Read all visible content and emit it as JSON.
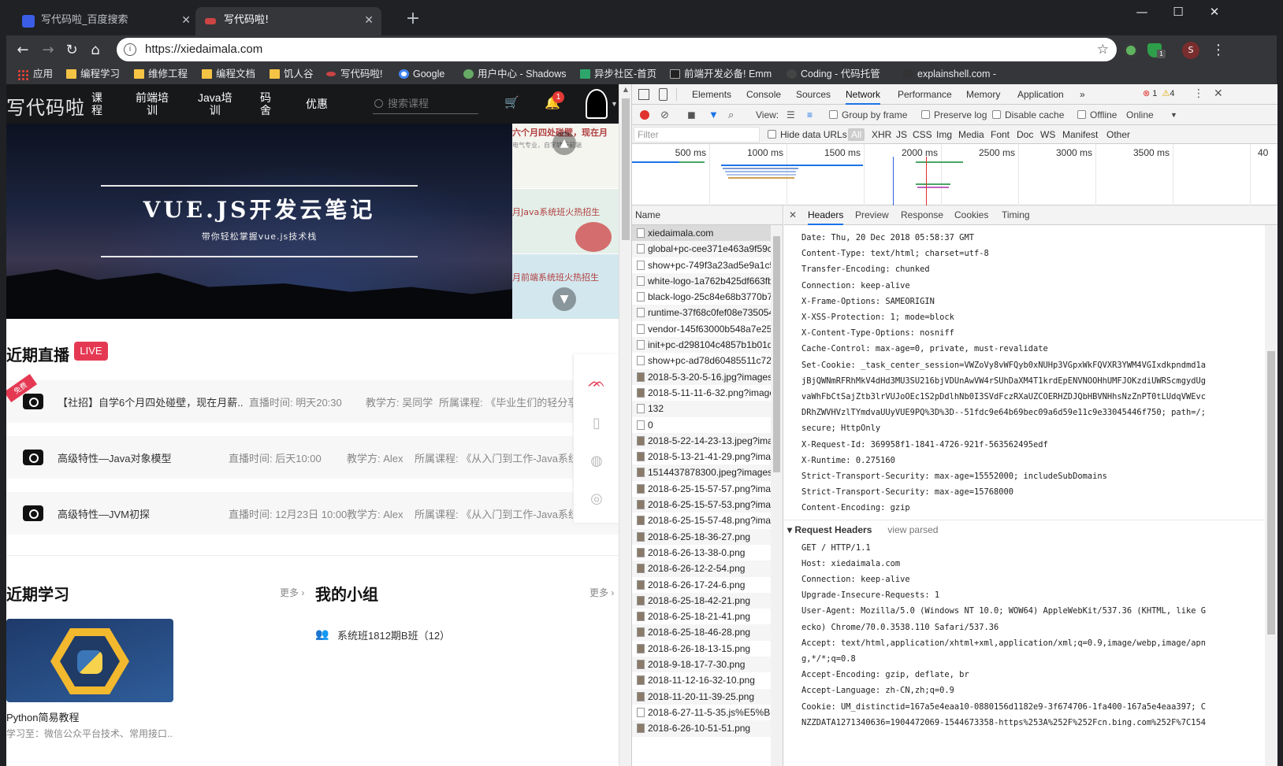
{
  "browser": {
    "tabs": [
      {
        "title": "写代码啦_百度搜索"
      },
      {
        "title": "写代码啦!"
      }
    ],
    "url": "https://xiedaimala.com",
    "bookmarks": [
      "应用",
      "编程学习",
      "维修工程",
      "编程文档",
      "饥人谷",
      "写代码啦!",
      "Google",
      "用户中心 - Shadows",
      "异步社区-首页",
      "前端开发必备! Emm",
      "Coding - 代码托管",
      "explainshell.com - r"
    ],
    "profile_letter": "S",
    "ext_badge": "1"
  },
  "site": {
    "logo": "写代码啦",
    "nav": [
      "课\n程",
      "前端培\n训",
      "Java培\n训",
      "码\n舍",
      "优惠"
    ],
    "search_placeholder": "搜索课程",
    "notif_count": "1",
    "banner_title": "VUE.JS开发云笔记",
    "banner_sub": "带你轻松掌握vue.js技术栈",
    "side_banners": [
      "六个月四处碰壁，现在月",
      "月Java系统班火热招生",
      "月前端系统班火热招生"
    ],
    "side_sub": "电气专业，自学转行前端",
    "live_title": "近期直播",
    "live_badge": "LIVE",
    "free_tag": "免费",
    "lives": [
      {
        "title": "【社招】自学6个月四处碰壁，现在月薪...",
        "time": "直播时间: 明天20:30",
        "teacher": "教学方: 吴同学",
        "course": "所属课程: 《毕业生们的轻分享合集》"
      },
      {
        "title": "高级特性—Java对象模型",
        "time": "直播时间: 后天10:00",
        "teacher": "教学方: Alex",
        "course": "所属课程: 《从入门到工作-Java系统班"
      },
      {
        "title": "高级特性—JVM初探",
        "time": "直播时间: 12月23日 10:00",
        "teacher": "教学方: Alex",
        "course": "所属课程: 《从入门到工作-Java系统班 ..."
      }
    ],
    "recent_title": "近期学习",
    "group_title": "我的小组",
    "more": "更多 ›",
    "course_title": "Python简易教程",
    "course_desc": "学习至：微信公众平台技术、常用接口...",
    "group_item": "系统班1812期B班（12）"
  },
  "devtools": {
    "tabs": [
      "Elements",
      "Console",
      "Sources",
      "Network",
      "Performance",
      "Memory",
      "Application",
      "»"
    ],
    "errors": "1",
    "warnings": "4",
    "toolbar": {
      "view": "View:",
      "group_by_frame": "Group by frame",
      "preserve_log": "Preserve log",
      "disable_cache": "Disable cache",
      "offline": "Offline",
      "online": "Online"
    },
    "filter": {
      "placeholder": "Filter",
      "hide_data_urls": "Hide data URLs",
      "all": "All",
      "types": [
        "XHR",
        "JS",
        "CSS",
        "Img",
        "Media",
        "Font",
        "Doc",
        "WS",
        "Manifest",
        "Other"
      ]
    },
    "timeline_labels": [
      "500 ms",
      "1000 ms",
      "1500 ms",
      "2000 ms",
      "2500 ms",
      "3000 ms",
      "3500 ms",
      "40"
    ],
    "name_header": "Name",
    "requests": [
      "xiedaimala.com",
      "global+pc-cee371e463a9f59cd",
      "show+pc-749f3a23ad5e9a1c5",
      "white-logo-1a762b425df663fb",
      "black-logo-25c84e68b3770b7",
      "runtime-37f68c0fef08e735054",
      "vendor-145f63000b548a7e25b",
      "init+pc-d298104c4857b1b01d",
      "show+pc-ad78d60485511c728",
      "2018-5-3-20-5-16.jpg?images",
      "2018-5-11-11-6-32.png?image",
      "132",
      "0",
      "2018-5-22-14-23-13.jpeg?ima",
      "2018-5-13-21-41-29.png?ima",
      "1514437878300.jpeg?imagesli",
      "2018-6-25-15-57-57.png?ima",
      "2018-6-25-15-57-53.png?ima",
      "2018-6-25-15-57-48.png?ima",
      "2018-6-25-18-36-27.png",
      "2018-6-26-13-38-0.png",
      "2018-6-26-12-2-54.png",
      "2018-6-26-17-24-6.png",
      "2018-6-25-18-42-21.png",
      "2018-6-25-18-21-41.png",
      "2018-6-25-18-46-28.png",
      "2018-6-26-18-13-15.png",
      "2018-9-18-17-7-30.png",
      "2018-11-12-16-32-10.png",
      "2018-11-20-11-39-25.png",
      "2018-6-27-11-5-35.js%E5%BC",
      "2018-6-26-10-51-51.png"
    ],
    "detail_tabs": [
      "Headers",
      "Preview",
      "Response",
      "Cookies",
      "Timing"
    ],
    "response_headers": [
      "Date: Thu, 20 Dec 2018 05:58:37 GMT",
      "Content-Type: text/html; charset=utf-8",
      "Transfer-Encoding: chunked",
      "Connection: keep-alive",
      "X-Frame-Options: SAMEORIGIN",
      "X-XSS-Protection: 1; mode=block",
      "X-Content-Type-Options: nosniff",
      "Cache-Control: max-age=0, private, must-revalidate",
      "Set-Cookie: _task_center_session=VWZoVy8vWFQyb0xNUHp3VGpxWkFQVXR3YWM4VGIxdkpndmd1a",
      "jBjQWNmRFRhMkV4dHd3MU3SU216bjVDUnAwVW4rSUhDaXM4T1krdEpENVNOOHhUMFJOKzdiUWRScmgydUg",
      "vaWhFbCtSajZtb3lrVUJoOEc1S2pDdlhNb0I3SVdFczRXaUZCOERHZDJQbHBVNHhsNzZnPT0tLUdqVWEvc",
      "DRhZWVHVzlTYmdvaUUyVUE9PQ%3D%3D--51fdc9e64b69bec09a6d59e11c9e33045446f750; path=/;",
      "secure; HttpOnly",
      "X-Request-Id: 369958f1-1841-4726-921f-563562495edf",
      "X-Runtime: 0.275160",
      "Strict-Transport-Security: max-age=15552000; includeSubDomains",
      "Strict-Transport-Security: max-age=15768000",
      "Content-Encoding: gzip"
    ],
    "request_headers_title": "Request Headers",
    "view_parsed": "view parsed",
    "request_headers": [
      "GET / HTTP/1.1",
      "Host: xiedaimala.com",
      "Connection: keep-alive",
      "Upgrade-Insecure-Requests: 1",
      "User-Agent: Mozilla/5.0 (Windows NT 10.0; WOW64) AppleWebKit/537.36 (KHTML, like G",
      "ecko) Chrome/70.0.3538.110 Safari/537.36",
      "Accept: text/html,application/xhtml+xml,application/xml;q=0.9,image/webp,image/apn",
      "g,*/*;q=0.8",
      "Accept-Encoding: gzip, deflate, br",
      "Accept-Language: zh-CN,zh;q=0.9",
      "Cookie: UM_distinctid=167a5e4eaa10-0880156d1182e9-3f674706-1fa400-167a5e4eaa397; C",
      "NZZDATA1271340636=1904472069-1544673358-https%253A%252F%252Fcn.bing.com%252F%7C154"
    ]
  }
}
